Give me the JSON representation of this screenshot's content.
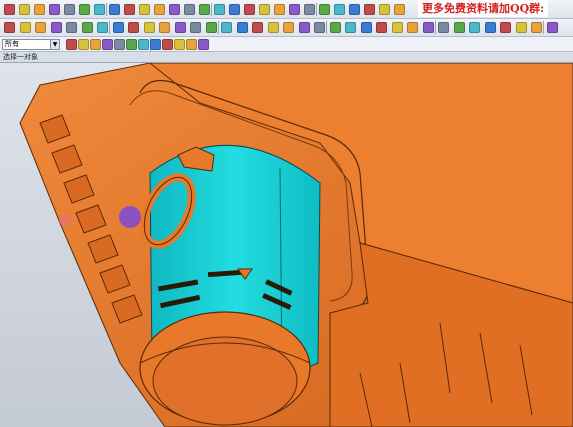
{
  "watermark": {
    "text": "更多免费资料请加QQ群:"
  },
  "selection_filter": {
    "value": "所有"
  },
  "breadcrumb": {
    "text": "选择一对象"
  },
  "colors": {
    "part_orange": "#e8782a",
    "face_cyan": "#18d6dc",
    "background": "#c9cfd8",
    "cursor_purple": "#7b48d8",
    "watermark_red": "#d42020"
  },
  "icons": [
    "toolbar-button-icon",
    "selection-filter-icon",
    "snap-point-icon",
    "view-orientation-icon",
    "cursor-marker-icon"
  ]
}
